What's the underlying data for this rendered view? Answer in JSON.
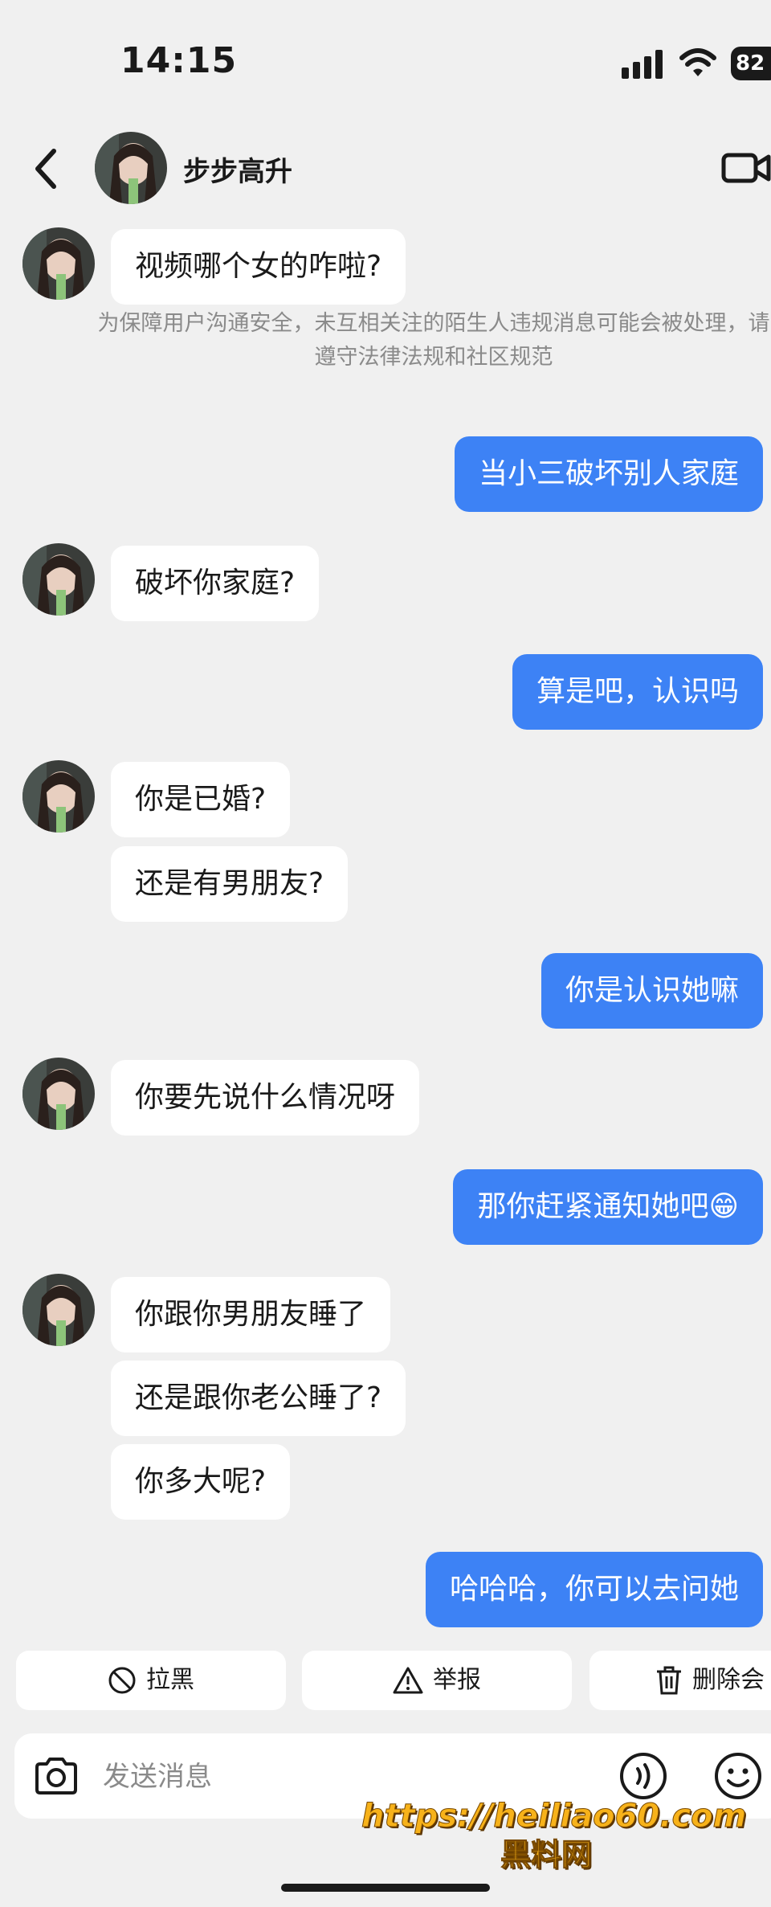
{
  "status_bar": {
    "time": "14:15",
    "battery": "82"
  },
  "header": {
    "contact_name": "步步高升",
    "back_icon": "chevron-left-icon",
    "call_icon": "video-camera-icon"
  },
  "messages": [
    {
      "side": "in",
      "text": "视频哪个女的咋啦?"
    },
    {
      "side": "out",
      "text": "当小三破坏别人家庭"
    },
    {
      "side": "in",
      "text": "破坏你家庭?"
    },
    {
      "side": "out",
      "text": "算是吧，认识吗"
    },
    {
      "side": "in",
      "text": "你是已婚?"
    },
    {
      "side": "in",
      "text": "还是有男朋友?"
    },
    {
      "side": "out",
      "text": "你是认识她嘛"
    },
    {
      "side": "in",
      "text": "你要先说什么情况呀"
    },
    {
      "side": "out",
      "text": "那你赶紧通知她吧😁"
    },
    {
      "side": "in",
      "text": "你跟你男朋友睡了"
    },
    {
      "side": "in",
      "text": "还是跟你老公睡了?"
    },
    {
      "side": "in",
      "text": "你多大呢?"
    },
    {
      "side": "out",
      "text": "哈哈哈，你可以去问她"
    }
  ],
  "notice": "为保障用户沟通安全，未互相关注的陌生人违规消息可能会被处理，请遵守法律法规和社区规范",
  "actions": {
    "block_label": "拉黑",
    "report_label": "举报",
    "delete_label": "删除会"
  },
  "input": {
    "placeholder": "发送消息"
  },
  "watermark": {
    "url": "https://heiliao60.com",
    "name": "黑料网"
  },
  "colors": {
    "background": "#f0f0f0",
    "outgoing_bubble": "#3d82f5",
    "incoming_bubble": "#ffffff",
    "notice_text": "#8a8a8a",
    "watermark": "#f7b21a"
  }
}
